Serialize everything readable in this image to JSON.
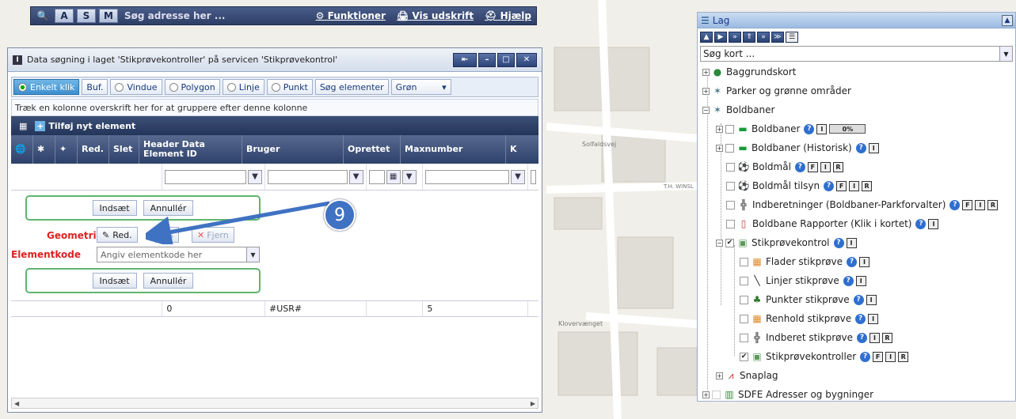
{
  "topbar": {
    "mode_buttons": [
      "A",
      "S",
      "M"
    ],
    "search_placeholder": "Søg adresse her ...",
    "links": [
      "Funktioner",
      "Vis udskrift",
      "Hjælp"
    ]
  },
  "dialog": {
    "title": "Data søgning i laget 'Stikprøvekontroller' på servicen 'Stikprøvekontrol'",
    "toolbar": {
      "enkelt_klik": "Enkelt klik",
      "buf": "Buf.",
      "vindue": "Vindue",
      "polygon": "Polygon",
      "linje": "Linje",
      "punkt": "Punkt",
      "sog_elementer": "Søg elementer",
      "color_select": "Grøn"
    },
    "group_hint": "Træk en kolonne overskrift her for at gruppere efter denne kolonne",
    "add_element": "Tilføj nyt element",
    "columns": [
      "Red.",
      "Slet",
      "Header Data Element ID",
      "Bruger",
      "Oprettet",
      "Maxnumber",
      "K"
    ],
    "form": {
      "indsaet": "Indsæt",
      "annuller": "Annullér",
      "geometri_label": "Geometri",
      "red": "Red.",
      "vis": "Vis",
      "fjern": "Fjern",
      "elementkode_label": "Elementkode",
      "elementkode_placeholder": "Angiv elementkode her"
    },
    "row": {
      "header_id": "0",
      "bruger": "#USR#",
      "maxnumber": "5"
    }
  },
  "callout": {
    "number": "9"
  },
  "map_labels": {
    "street1": "Solfaldsvej",
    "street2": "Klovervænget",
    "street3": "T.H. WINSL"
  },
  "layers_panel": {
    "title": "Lag",
    "search_placeholder": "Søg kort ...",
    "items": [
      {
        "label": "Baggrundskort"
      },
      {
        "label": "Parker og grønne områder"
      },
      {
        "label": "Boldbaner"
      },
      {
        "label": "Boldbaner",
        "progress": "0%"
      },
      {
        "label": "Boldbaner (Historisk)"
      },
      {
        "label": "Boldmål"
      },
      {
        "label": "Boldmål tilsyn"
      },
      {
        "label": "Indberetninger (Boldbaner-Parkforvalter)"
      },
      {
        "label": "Boldbane Rapporter (Klik i kortet)"
      },
      {
        "label": "Stikprøvekontrol"
      },
      {
        "label": "Flader stikprøve"
      },
      {
        "label": "Linjer stikprøve"
      },
      {
        "label": "Punkter stikprøve"
      },
      {
        "label": "Renhold stikprøve"
      },
      {
        "label": "Indberet stikprøve"
      },
      {
        "label": "Stikprøvekontroller"
      },
      {
        "label": "Snaplag"
      },
      {
        "label": "SDFE Adresser og bygninger"
      }
    ]
  }
}
